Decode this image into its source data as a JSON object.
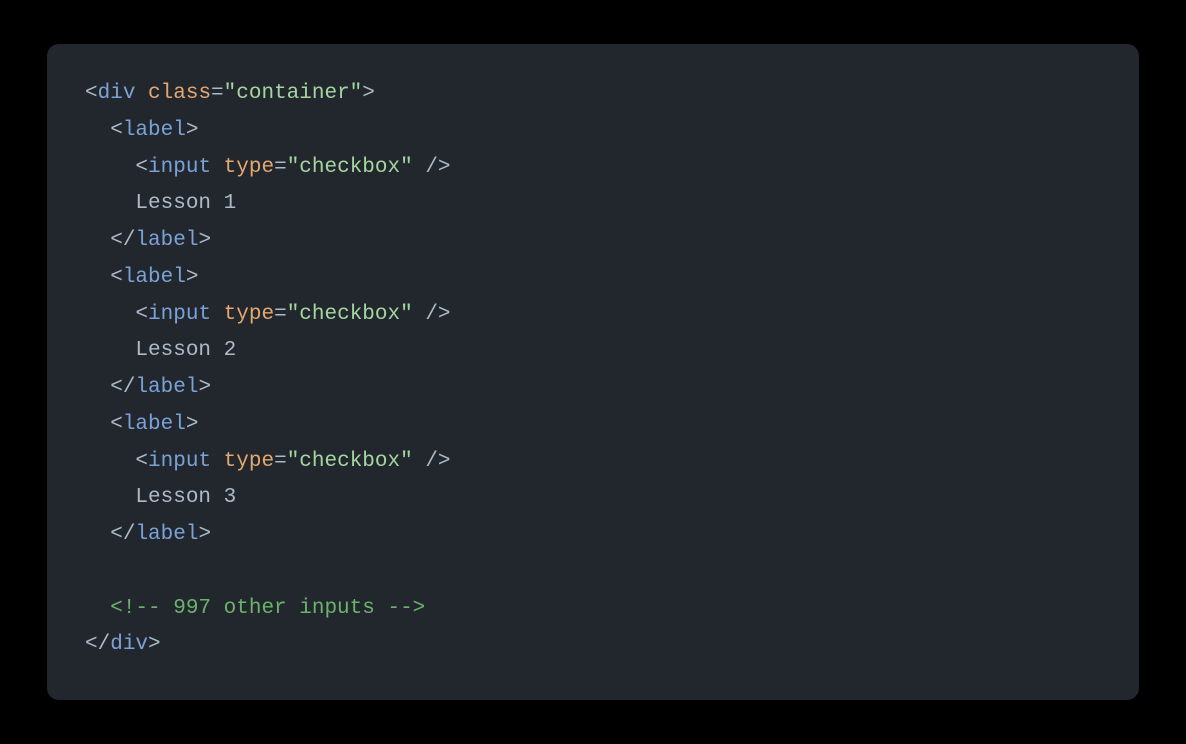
{
  "code": {
    "line1": {
      "bracket_open": "<",
      "tag": "div",
      "attr": "class",
      "equals": "=",
      "value": "\"container\"",
      "bracket_close": ">"
    },
    "label_open": {
      "bracket_open": "<",
      "tag": "label",
      "bracket_close": ">"
    },
    "label_close": {
      "bracket_open": "</",
      "tag": "label",
      "bracket_close": ">"
    },
    "input": {
      "bracket_open": "<",
      "tag": "input",
      "attr": "type",
      "equals": "=",
      "value": "\"checkbox\"",
      "self_close": " />"
    },
    "lesson1": "Lesson 1",
    "lesson2": "Lesson 2",
    "lesson3": "Lesson 3",
    "comment": "<!-- 997 other inputs -->",
    "div_close": {
      "bracket_open": "</",
      "tag": "div",
      "bracket_close": ">"
    },
    "indent1": "  ",
    "indent2": "    "
  }
}
